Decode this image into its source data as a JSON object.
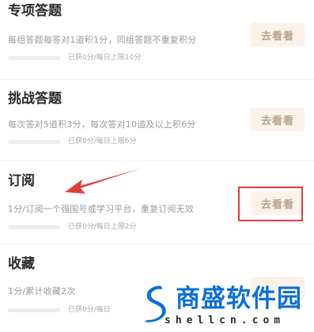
{
  "tasks": [
    {
      "title": "专项答题",
      "description": "每组答题每答对1道积1分，同组答题不重复积分",
      "progress_text": "已获0分/每日上限10分",
      "progress": 0,
      "button_label": "去看看"
    },
    {
      "title": "挑战答题",
      "description": "每次答对5道积3分，每次答对10道及以上积6分",
      "progress_text": "已获0分/每日上限6分",
      "progress": 0,
      "button_label": "去看看"
    },
    {
      "title": "订阅",
      "description": "1分/订阅一个强国号或学习平台，重复订阅无效",
      "progress_text": "已获0分/每日上限2分",
      "progress": 0,
      "button_label": "去看看"
    },
    {
      "title": "收藏",
      "description": "1分/累计收藏2次",
      "progress_text": "已获0分/每日",
      "progress": 0,
      "button_label": ""
    }
  ],
  "watermark": {
    "brand": "商盛软件园",
    "domain": "shellcn.com"
  },
  "colors": {
    "button_bg": "#fbf2ea",
    "button_text": "#b7a28d",
    "highlight": "#e03c3c",
    "watermark_blue": "#0b6fd6"
  }
}
